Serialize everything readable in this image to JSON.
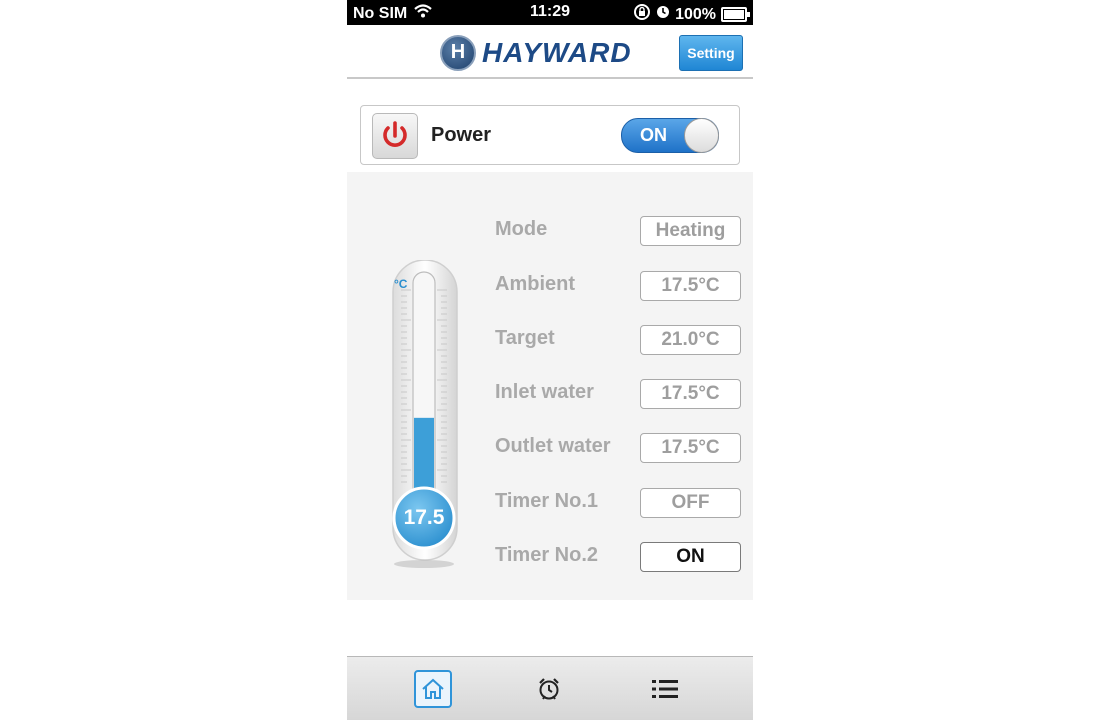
{
  "status_bar": {
    "carrier": "No SIM",
    "time": "11:29",
    "battery": "100%",
    "icons": [
      "wifi-icon",
      "rotation-lock-icon",
      "alarm-icon",
      "battery-icon"
    ]
  },
  "header": {
    "brand": "HAYWARD",
    "brand_mark": "H",
    "setting_label": "Setting"
  },
  "power": {
    "label": "Power",
    "toggle_label": "ON",
    "is_on": true
  },
  "thermometer": {
    "unit": "°C",
    "reading": "17.5",
    "fill_fraction": 0.42
  },
  "rows": [
    {
      "label": "Mode",
      "value": "Heating"
    },
    {
      "label": "Ambient",
      "value": "17.5°C"
    },
    {
      "label": "Target",
      "value": "21.0°C"
    },
    {
      "label": "Inlet water",
      "value": "17.5°C"
    },
    {
      "label": "Outlet water",
      "value": "17.5°C"
    },
    {
      "label": "Timer No.1",
      "value": "OFF"
    },
    {
      "label": "Timer No.2",
      "value": "ON"
    }
  ],
  "tabs": [
    {
      "icon": "home-icon",
      "active": true
    },
    {
      "icon": "alarm-clock-icon",
      "active": false
    },
    {
      "icon": "list-icon",
      "active": false
    }
  ],
  "colors": {
    "accent": "#1f86d4",
    "power_red": "#d42a2a",
    "thermo_fill": "#3d9fd8"
  }
}
